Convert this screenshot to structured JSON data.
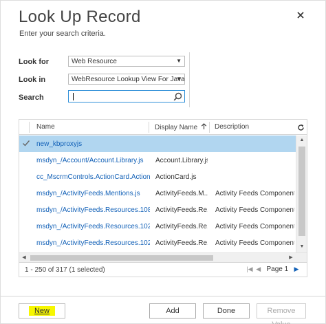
{
  "dialog": {
    "title": "Look Up Record",
    "subtitle": "Enter your search criteria."
  },
  "criteria": {
    "look_for_label": "Look for",
    "look_for_value": "Web Resource",
    "look_in_label": "Look in",
    "look_in_value": "WebResource Lookup View For Java",
    "search_label": "Search",
    "search_value": ""
  },
  "grid": {
    "columns": [
      "Name",
      "Display Name",
      "Description"
    ],
    "rows": [
      {
        "name": "new_kbproxyjs",
        "display": "",
        "description": "",
        "selected": true
      },
      {
        "name": "msdyn_/Account/Account.Library.js",
        "display": "Account.Library.js",
        "description": "",
        "selected": false
      },
      {
        "name": "cc_MscrmControls.ActionCard.Action...",
        "display": "ActionCard.js",
        "description": "",
        "selected": false
      },
      {
        "name": "msdyn_/ActivityFeeds.Mentions.js",
        "display": "ActivityFeeds.M...",
        "description": "Activity Feeds Component",
        "selected": false
      },
      {
        "name": "msdyn_/ActivityFeeds.Resources.108...",
        "display": "ActivityFeeds.Re...",
        "description": "Activity Feeds Component",
        "selected": false
      },
      {
        "name": "msdyn_/ActivityFeeds.Resources.102...",
        "display": "ActivityFeeds.Re...",
        "description": "Activity Feeds Component",
        "selected": false
      },
      {
        "name": "msdyn_/ActivityFeeds.Resources.102...",
        "display": "ActivityFeeds.Re...",
        "description": "Activity Feeds Component",
        "selected": false
      }
    ],
    "status": "1 - 250 of 317 (1 selected)",
    "page_label": "Page 1"
  },
  "buttons": {
    "new": "New",
    "add": "Add",
    "done": "Done",
    "remove": "Remove Value"
  },
  "colors": {
    "link": "#1160b7",
    "selected_row": "#b1d6f0",
    "highlight": "#f7f700"
  }
}
